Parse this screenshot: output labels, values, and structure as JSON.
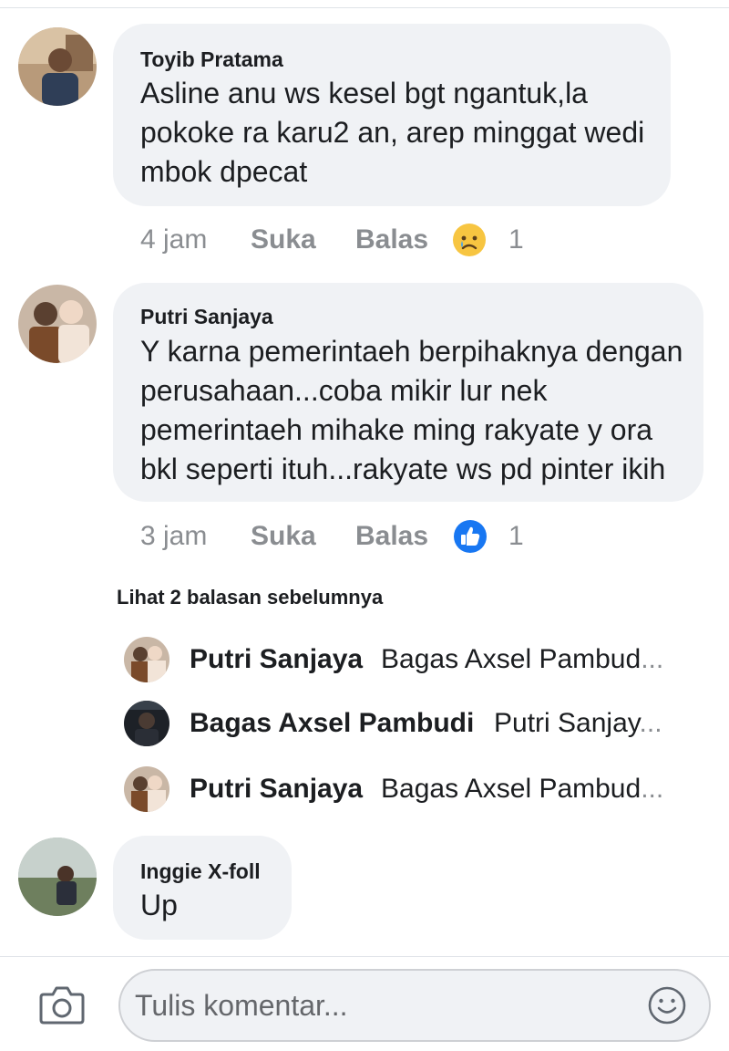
{
  "comments": [
    {
      "author": "Toyib Pratama",
      "text": "Asline anu ws kesel bgt ngantuk,la\npokoke ra karu2 an, arep minggat wedi\nmbok dpecat",
      "time": "4 jam",
      "like_label": "Suka",
      "reply_label": "Balas",
      "reaction_icon": "sad-reaction-icon",
      "reaction_count": "1"
    },
    {
      "author": "Putri Sanjaya",
      "text": "Y karna pemerintaeh berpihaknya dengan\nperusahaan...coba mikir lur nek\npemerintaeh mihake ming rakyate y ora\nbkl seperti ituh...rakyate ws pd pinter ikih",
      "time": "3 jam",
      "like_label": "Suka",
      "reply_label": "Balas",
      "reaction_icon": "like-reaction-icon",
      "reaction_count": "1"
    },
    {
      "author": "Inggie X-foll",
      "text": "Up"
    }
  ],
  "replies": {
    "see_previous": "Lihat 2 balasan sebelumnya",
    "items": [
      {
        "author": "Putri Sanjaya",
        "preview": "Bagas Axsel Pambud",
        "ellipsis": "..."
      },
      {
        "author": "Bagas Axsel Pambudi",
        "preview": "Putri Sanjay",
        "ellipsis": "..."
      },
      {
        "author": "Putri Sanjaya",
        "preview": "Bagas Axsel Pambud",
        "ellipsis": "..."
      }
    ]
  },
  "composer": {
    "placeholder": "Tulis komentar..."
  },
  "colors": {
    "bubble": "#f0f2f5",
    "meta_text": "#8a8d91",
    "like_blue": "#1877f2",
    "sad_yellow": "#f7c541"
  }
}
